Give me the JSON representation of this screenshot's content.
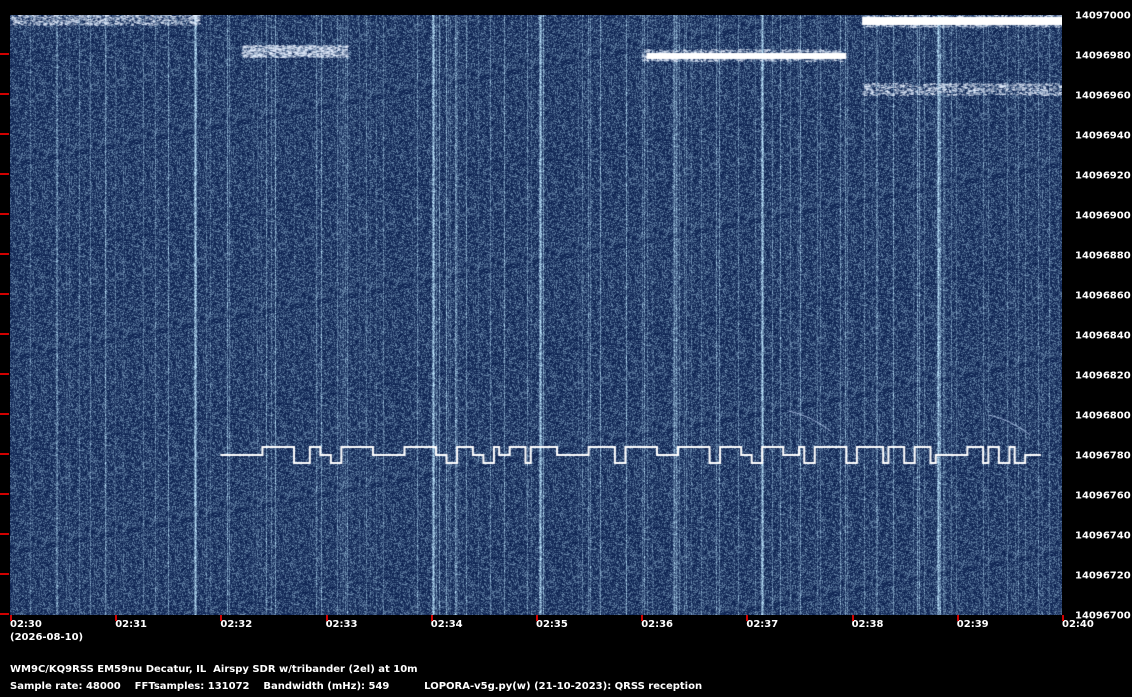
{
  "chart_data": {
    "type": "heatmap",
    "title": "",
    "xlabel": "",
    "ylabel": "",
    "x_tick_labels": [
      "02:30",
      "02:31",
      "02:32",
      "02:33",
      "02:34",
      "02:35",
      "02:36",
      "02:37",
      "02:38",
      "02:39",
      "02:40"
    ],
    "y_tick_labels": [
      "14097000",
      "14096980",
      "14096960",
      "14096940",
      "14096920",
      "14096900",
      "14096880",
      "14096860",
      "14096840",
      "14096820",
      "14096800",
      "14096780",
      "14096760",
      "14096740",
      "14096720",
      "14096700"
    ],
    "x_range_minutes": [
      0,
      10
    ],
    "y_range_hz": [
      14096700,
      14097000
    ],
    "background_color": "#0a1f4e",
    "signal_color": "#ffffff",
    "tick_color": "#d00000",
    "signal_trace": {
      "description_frequency_base_hz": 14096780,
      "frequency_high_hz": 14096784,
      "frequency_low_hz": 14096776,
      "start_minute": 2.0,
      "end_minute": 9.8,
      "segments": [
        [
          2.0,
          "mid"
        ],
        [
          2.4,
          "high"
        ],
        [
          2.7,
          "low"
        ],
        [
          2.85,
          "high"
        ],
        [
          2.95,
          "mid"
        ],
        [
          3.05,
          "low"
        ],
        [
          3.15,
          "high"
        ],
        [
          3.45,
          "mid"
        ],
        [
          3.75,
          "high"
        ],
        [
          4.05,
          "mid"
        ],
        [
          4.15,
          "low"
        ],
        [
          4.25,
          "high"
        ],
        [
          4.4,
          "mid"
        ],
        [
          4.5,
          "low"
        ],
        [
          4.6,
          "high"
        ],
        [
          4.65,
          "mid"
        ],
        [
          4.75,
          "high"
        ],
        [
          4.9,
          "low"
        ],
        [
          4.95,
          "high"
        ],
        [
          5.2,
          "mid"
        ],
        [
          5.5,
          "high"
        ],
        [
          5.75,
          "low"
        ],
        [
          5.85,
          "high"
        ],
        [
          6.15,
          "mid"
        ],
        [
          6.35,
          "high"
        ],
        [
          6.65,
          "low"
        ],
        [
          6.75,
          "high"
        ],
        [
          6.95,
          "mid"
        ],
        [
          7.05,
          "low"
        ],
        [
          7.15,
          "high"
        ],
        [
          7.35,
          "mid"
        ],
        [
          7.5,
          "high"
        ],
        [
          7.55,
          "low"
        ],
        [
          7.65,
          "high"
        ],
        [
          7.95,
          "low"
        ],
        [
          8.05,
          "high"
        ],
        [
          8.3,
          "low"
        ],
        [
          8.35,
          "high"
        ],
        [
          8.5,
          "low"
        ],
        [
          8.6,
          "high"
        ],
        [
          8.75,
          "low"
        ],
        [
          8.8,
          "mid"
        ],
        [
          9.1,
          "high"
        ],
        [
          9.25,
          "low"
        ],
        [
          9.3,
          "high"
        ],
        [
          9.4,
          "low"
        ],
        [
          9.5,
          "high"
        ],
        [
          9.55,
          "low"
        ],
        [
          9.65,
          "mid"
        ],
        [
          9.8,
          "end"
        ]
      ]
    },
    "interference_bands": [
      {
        "start_minute": 0.0,
        "end_minute": 1.8,
        "freq_hz": 14096998
      },
      {
        "start_minute": 2.2,
        "end_minute": 3.2,
        "freq_hz": 14096982
      },
      {
        "start_minute": 6.0,
        "end_minute": 7.9,
        "freq_hz": 14096980
      },
      {
        "start_minute": 8.1,
        "end_minute": 10.0,
        "freq_hz": 14096997
      },
      {
        "start_minute": 8.1,
        "end_minute": 10.0,
        "freq_hz": 14096963
      }
    ]
  },
  "date_label": "(2026-08-10)",
  "footer": {
    "line1": "WM9C/KQ9RSS EM59nu Decatur, IL  Airspy SDR w/tribander (2el) at 10m",
    "line2": "Sample rate: 48000    FFTsamples: 131072    Bandwidth (mHz): 549          LOPORA-v5g.py(w) (21-10-2023): QRSS reception"
  }
}
